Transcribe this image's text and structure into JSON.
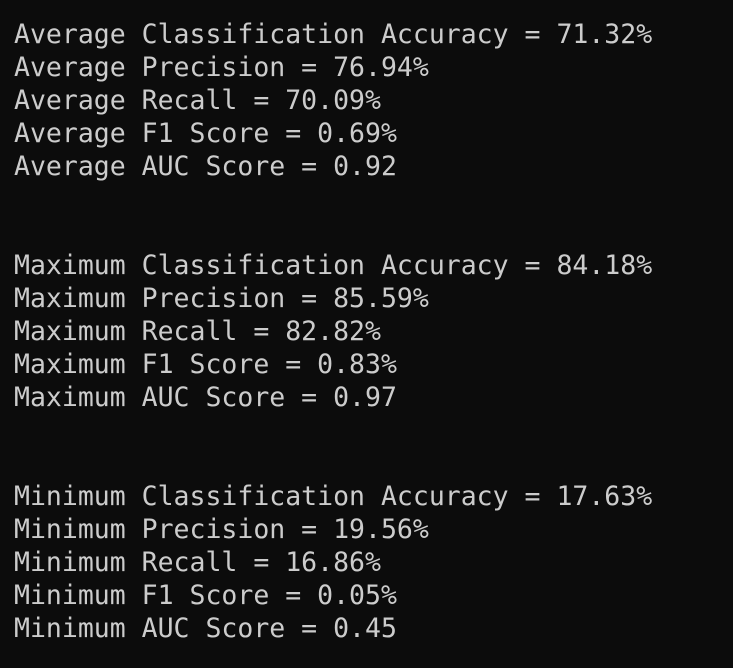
{
  "terminal": {
    "average": [
      "Average Classification Accuracy = 71.32%",
      "Average Precision = 76.94%",
      "Average Recall = 70.09%",
      "Average F1 Score = 0.69%",
      "Average AUC Score = 0.92"
    ],
    "maximum": [
      "Maximum Classification Accuracy = 84.18%",
      "Maximum Precision = 85.59%",
      "Maximum Recall = 82.82%",
      "Maximum F1 Score = 0.83%",
      "Maximum AUC Score = 0.97"
    ],
    "minimum": [
      "Minimum Classification Accuracy = 17.63%",
      "Minimum Precision = 19.56%",
      "Minimum Recall = 16.86%",
      "Minimum F1 Score = 0.05%",
      "Minimum AUC Score = 0.45"
    ]
  },
  "colors": {
    "background": "#0c0c0c",
    "text": "#cccccc"
  }
}
